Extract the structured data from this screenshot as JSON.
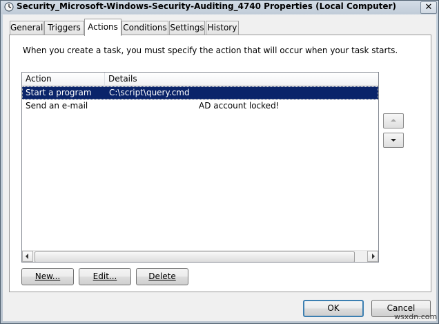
{
  "window": {
    "title": "Security_Microsoft-Windows-Security-Auditing_4740 Properties (Local Computer)",
    "close_glyph": "✕"
  },
  "tabs": [
    {
      "label": "General",
      "active": false
    },
    {
      "label": "Triggers",
      "active": false
    },
    {
      "label": "Actions",
      "active": true
    },
    {
      "label": "Conditions",
      "active": false
    },
    {
      "label": "Settings",
      "active": false
    },
    {
      "label": "History",
      "active": false
    }
  ],
  "actions_tab": {
    "description": "When you create a task, you must specify the action that will occur when your task starts.",
    "columns": [
      "Action",
      "Details"
    ],
    "rows": [
      {
        "action": "Start a program",
        "details": "C:\\script\\query.cmd",
        "selected": true
      },
      {
        "action": "Send an e-mail",
        "details": "AD account locked!",
        "selected": false
      }
    ],
    "buttons": {
      "new": "New...",
      "edit": "Edit...",
      "delete": "Delete"
    }
  },
  "footer": {
    "ok": "OK",
    "cancel": "Cancel"
  },
  "watermark": "wsxdn.com",
  "colors": {
    "selection": "#0a246a",
    "default_button_border": "#3c7fb1"
  },
  "icons": [
    "clock-icon",
    "close-icon",
    "scroll-left-icon",
    "scroll-right-icon",
    "move-up-icon",
    "move-down-icon"
  ]
}
